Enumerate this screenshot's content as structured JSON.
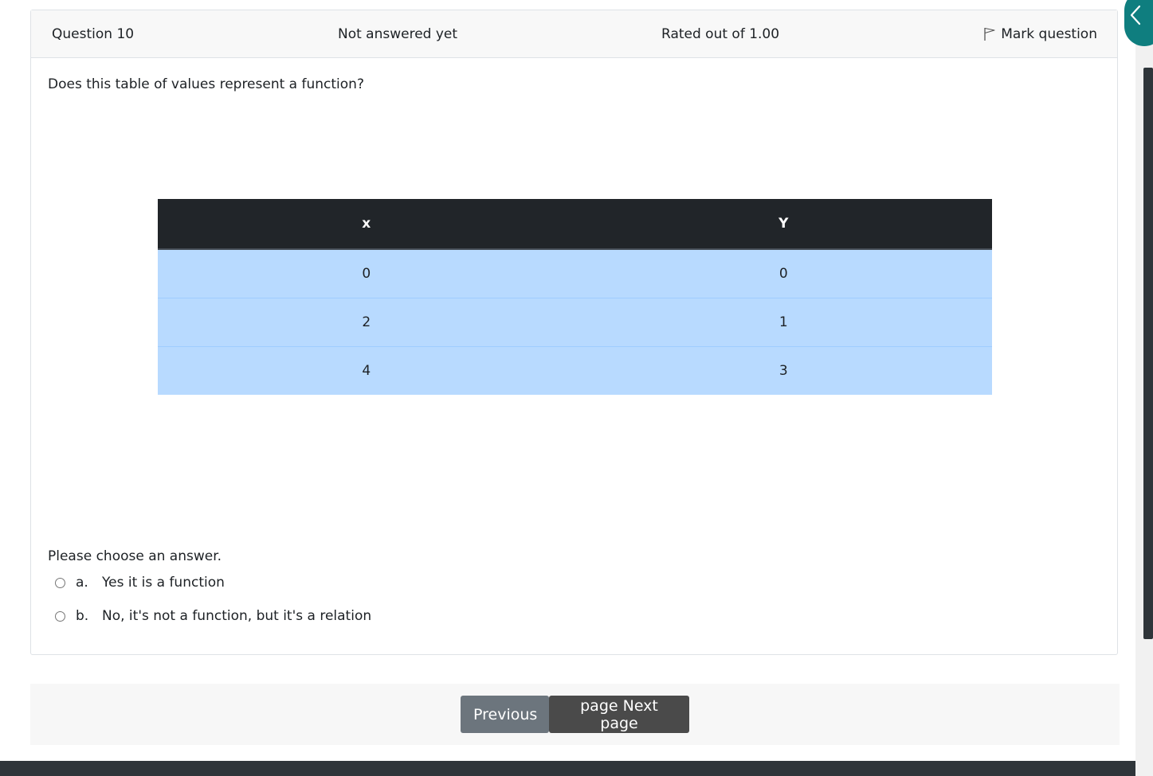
{
  "question": {
    "number_label": "Question 10",
    "state": "Not answered yet",
    "grade": "Rated out of 1.00",
    "flag_label": "Mark question",
    "prompt": "Does this table of values represent a function?",
    "table": {
      "headers": [
        "x",
        "Y"
      ],
      "rows": [
        [
          "0",
          "0"
        ],
        [
          "2",
          "1"
        ],
        [
          "4",
          "3"
        ]
      ]
    },
    "choose_label": "Please choose an answer.",
    "answers": [
      {
        "letter": "a.",
        "text": "Yes it is a function"
      },
      {
        "letter": "b.",
        "text": "No, it's not a function, but it's a relation"
      }
    ]
  },
  "navigation": {
    "previous_label": "Previous",
    "next_label": "page Next page"
  },
  "colors": {
    "accent": "#0f7e7f",
    "table_header": "#212529",
    "table_row": "#b8daff",
    "button_previous": "#6c757d",
    "button_next": "#4a4a4a"
  },
  "icons": {
    "flag": "flag-icon",
    "drawer_toggle": "chevron-left-icon"
  }
}
